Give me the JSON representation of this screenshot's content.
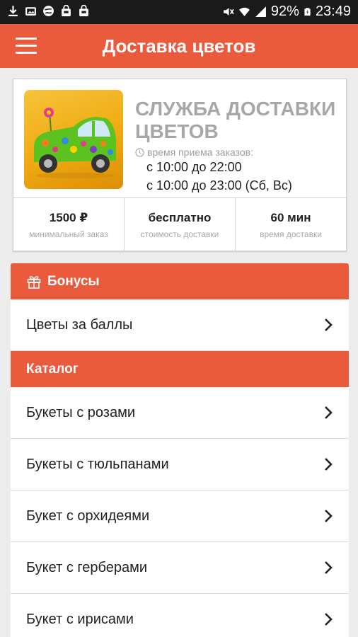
{
  "status_bar": {
    "battery": "92%",
    "time": "23:49"
  },
  "app_bar": {
    "title": "Доставка цветов"
  },
  "info_card": {
    "title": "СЛУЖБА ДОСТАВКИ ЦВЕТОВ",
    "hours_label": "время приема заказов:",
    "hours": [
      "с 10:00 до 22:00",
      "с 10:00 до 23:00 (Сб, Вс)"
    ],
    "stats": [
      {
        "value": "1500 ₽",
        "label": "минимальный заказ"
      },
      {
        "value": "бесплатно",
        "label": "стоимость доставки"
      },
      {
        "value": "60 мин",
        "label": "время доставки"
      }
    ]
  },
  "sections": {
    "bonuses": {
      "title": "Бонусы",
      "items": [
        "Цветы за баллы"
      ]
    },
    "catalog": {
      "title": "Каталог",
      "items": [
        "Букеты с розами",
        "Букеты с тюльпанами",
        "Букет с орхидеями",
        "Букет с герберами",
        "Букет с ирисами"
      ]
    }
  },
  "colors": {
    "accent": "#ea5a3c",
    "status_bar": "#1a1a1a",
    "background": "#ececec",
    "logo_bg": "#f2b21f"
  }
}
